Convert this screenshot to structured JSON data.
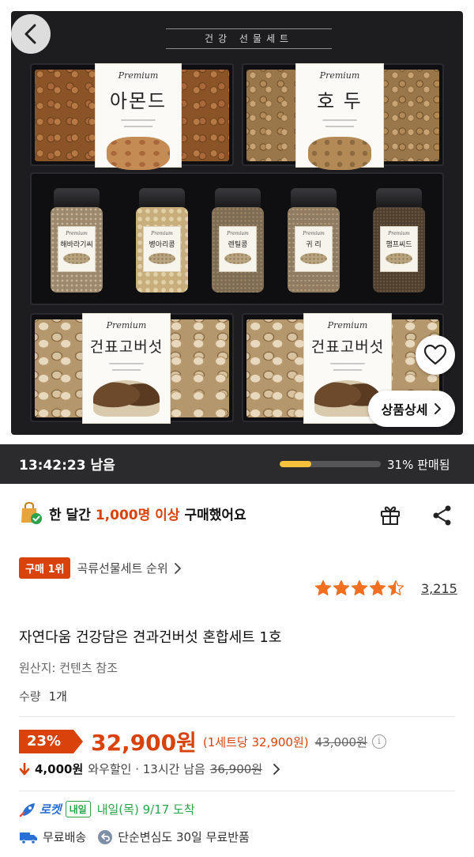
{
  "product_image": {
    "box_title": "건강 선물세트",
    "premium_label": "Premium",
    "trays": {
      "almond": "아몬드",
      "walnut": "호 두",
      "mushroom_left": "건표고버섯",
      "mushroom_right": "건표고버섯"
    },
    "jars": [
      "해바라기씨",
      "병아리콩",
      "렌틸콩",
      "귀 리",
      "햄프씨드"
    ],
    "detail_button": "상품상세"
  },
  "timer": {
    "remaining": "13:42:23 남음",
    "sold_percent": 31,
    "sold_label": "31% 판매됨"
  },
  "purchase_info": {
    "prefix": "한 달간",
    "highlight": "1,000명 이상",
    "suffix": "구매했어요"
  },
  "ranking": {
    "badge": "구매 1위",
    "category": "곡류선물세트 순위"
  },
  "rating": {
    "stars": 4.5,
    "review_count": "3,215"
  },
  "product": {
    "title": "자연다움 건강담은 견과건버섯 혼합세트 1호",
    "origin": "원산지: 컨텐츠 참조",
    "quantity_label": "수량",
    "quantity_value": "1개"
  },
  "price": {
    "discount": "23%",
    "sale_price": "32,900원",
    "unit_price": "(1세트당 32,900원)",
    "original_price": "43,000원"
  },
  "coupon": {
    "amount": "4,000원",
    "label": "와우할인 · 13시간 남음",
    "price_after": "36,900원"
  },
  "delivery": {
    "rocket": "로켓",
    "tomorrow_badge": "내일",
    "arrival": "내일(목) 9/17 도착",
    "free_shipping": "무료배송",
    "returns": "단순변심도 30일 무료반품"
  },
  "colors": {
    "accent": "#d9420b",
    "rocket_blue": "#2a6fd6",
    "green": "#2aa34a",
    "star": "#f37021",
    "progress": "#f6c23b"
  }
}
